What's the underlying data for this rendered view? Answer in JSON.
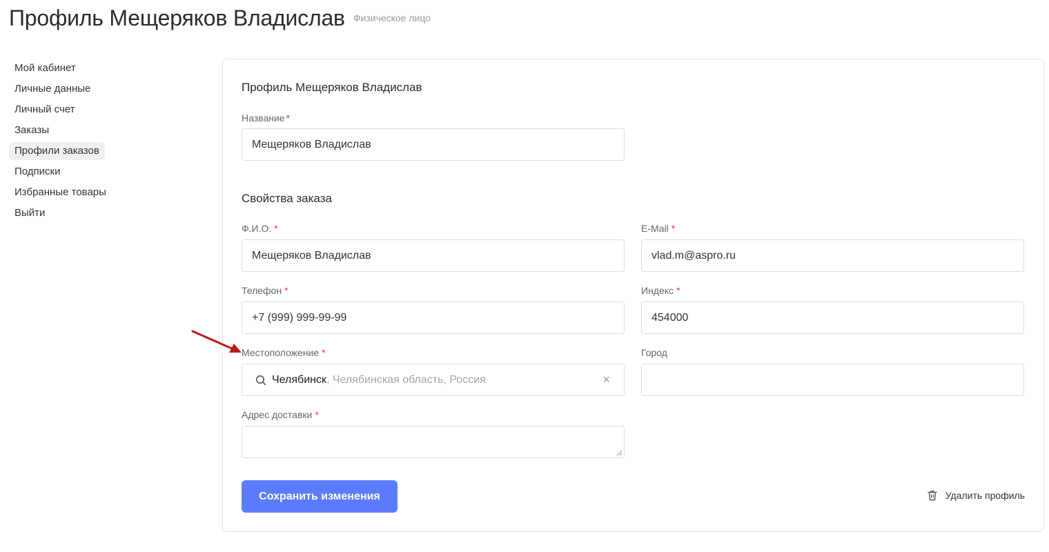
{
  "header": {
    "title": "Профиль Мещеряков Владислав",
    "subtitle": "Физическое лицо"
  },
  "sidebar": {
    "items": [
      {
        "label": "Мой кабинет",
        "active": false
      },
      {
        "label": "Личные данные",
        "active": false
      },
      {
        "label": "Личный счет",
        "active": false
      },
      {
        "label": "Заказы",
        "active": false
      },
      {
        "label": "Профили заказов",
        "active": true
      },
      {
        "label": "Подписки",
        "active": false
      },
      {
        "label": "Избранные товары",
        "active": false
      },
      {
        "label": "Выйти",
        "active": false
      }
    ]
  },
  "form": {
    "profile_heading": "Профиль Мещеряков Владислав",
    "name_label": "Название",
    "name_value": "Мещеряков Владислав",
    "properties_heading": "Свойства заказа",
    "fio_label": "Ф.И.О.",
    "fio_value": "Мещеряков Владислав",
    "email_label": "E-Mail",
    "email_value": "vlad.m@aspro.ru",
    "phone_label": "Телефон",
    "phone_value": "+7 (999) 999-99-99",
    "index_label": "Индекс",
    "index_value": "454000",
    "location_label": "Местоположение",
    "location_main": "Челябинск",
    "location_rest": ", Челябинская область, Россия",
    "location_clear": "×",
    "city_label": "Город",
    "city_value": "",
    "address_label": "Адрес доставки",
    "address_value": "",
    "required_mark": "*",
    "save_label": "Сохранить изменения",
    "delete_label": "Удалить профиль"
  },
  "colors": {
    "accent": "#5b7cff",
    "required": "#e53935",
    "annotation_arrow": "#b71c1c"
  }
}
